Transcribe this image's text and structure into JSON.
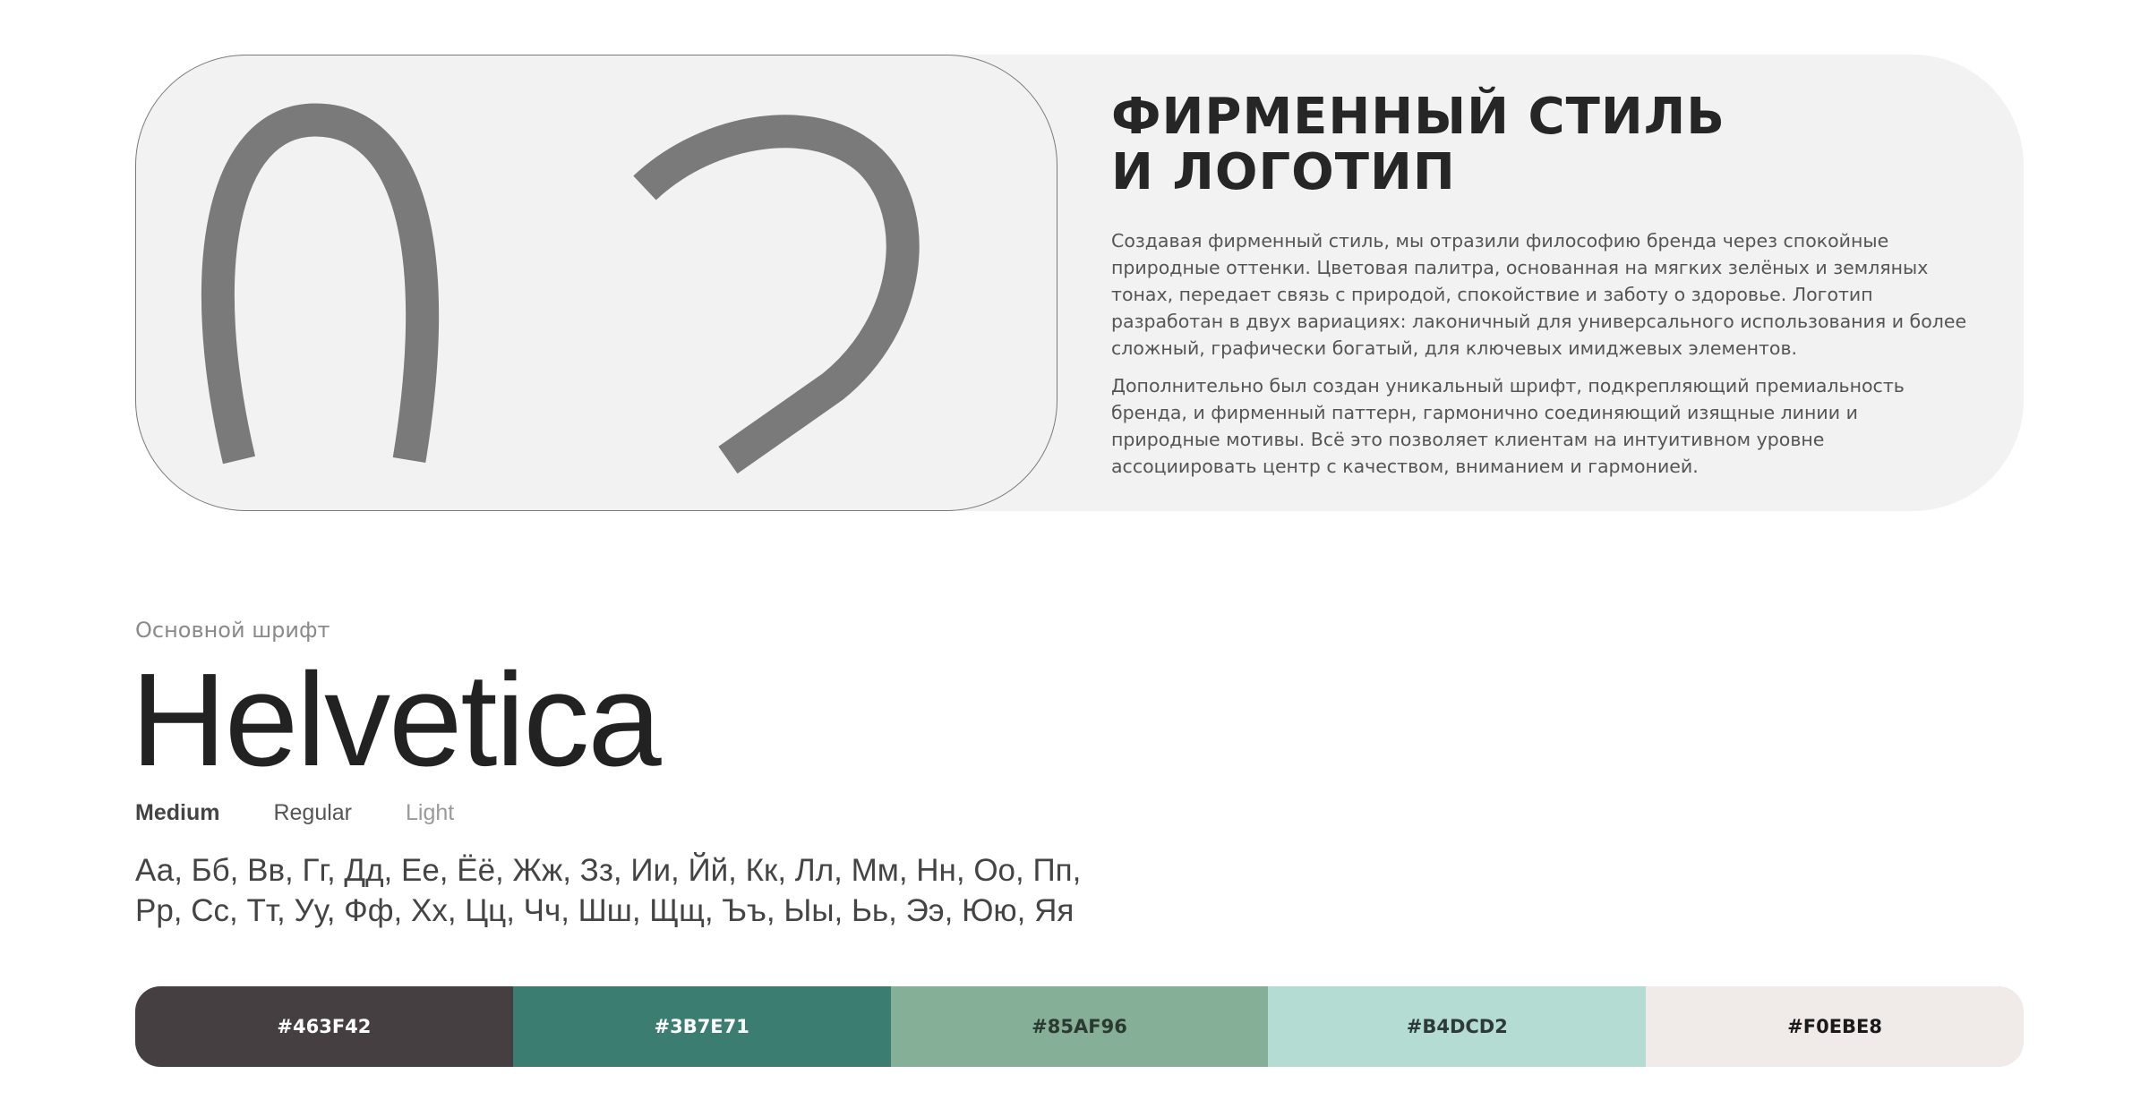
{
  "hero": {
    "numeral": "02",
    "title_line1": "ФИРМЕННЫЙ СТИЛЬ",
    "title_line2": "И ЛОГОТИП",
    "paragraph1": "Создавая фирменный стиль, мы отразили философию бренда через спокойные природные оттенки. Цветовая палитра, основанная на мягких зелёных и земляных тонах, передает связь с природой, спокойствие и заботу о здоровье. Логотип разработан в двух вариациях: лаконичный для универсального использования и более сложный, графически богатый, для ключевых имиджевых элементов.",
    "paragraph2": "Дополнительно был создан уникальный шрифт, подкрепляющий премиальность бренда, и фирменный паттерн, гармонично соединяющий изящные линии и природные мотивы. Всё это позволяет клиентам на интуитивном уровне ассоциировать центр с качеством, вниманием и гармонией."
  },
  "typography": {
    "caption": "Основной шрифт",
    "font_name": "Helvetica",
    "weights": {
      "medium": "Medium",
      "regular": "Regular",
      "light": "Light"
    },
    "alphabet_line1": "Аа, Бб, Вв, Гг, Дд, Ее, Ёё, Жж, Зз, Ии, Йй, Кк, Лл, Мм, Нн, Оо, Пп,",
    "alphabet_line2": "Рр, Сс, Тт, Уу, Фф, Хх, Цц, Чч, Шш, Щщ, Ъъ, Ыы, Ьь, Ээ, Юю, Яя"
  },
  "palette": [
    {
      "label": "#463F42",
      "color": "#463F42",
      "text_color": "#ffffff"
    },
    {
      "label": "#3B7E71",
      "color": "#3B7E71",
      "text_color": "#ffffff"
    },
    {
      "label": "#85AF96",
      "color": "#85AF96",
      "text_color": "#2b3a31"
    },
    {
      "label": "#B4DCD2",
      "color": "#B4DCD2",
      "text_color": "#2d3b38"
    },
    {
      "label": "#F0EBE8",
      "color": "#F0EBE8",
      "text_color": "#1a1a1a"
    }
  ],
  "colors": {
    "numeral": "#7a7a7a",
    "hero_bg": "#f2f2f2"
  }
}
